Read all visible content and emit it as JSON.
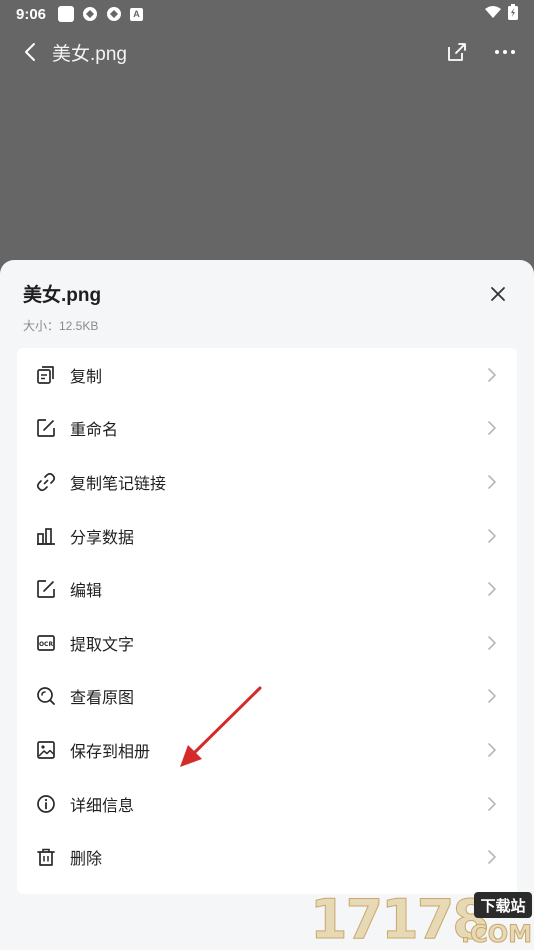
{
  "status_bar": {
    "time": "9:06",
    "badge_letter": "A",
    "icons_left": [
      "notification-square-icon",
      "sync-ring-icon",
      "sync-ring-icon",
      "a-badge-icon"
    ],
    "icons_right": [
      "wifi-icon",
      "battery-icon"
    ]
  },
  "app_bar": {
    "title": "美女.png",
    "actions": [
      "share-icon",
      "more-icon"
    ]
  },
  "sheet": {
    "title": "美女.png",
    "size": "大小：12.5KB",
    "items": [
      {
        "label": "复制",
        "icon": "copy-icon"
      },
      {
        "label": "重命名",
        "icon": "rename-icon"
      },
      {
        "label": "复制笔记链接",
        "icon": "link-icon"
      },
      {
        "label": "分享数据",
        "icon": "bar-chart-icon"
      },
      {
        "label": "编辑",
        "icon": "edit-icon"
      },
      {
        "label": "提取文字",
        "icon": "ocr-icon"
      },
      {
        "label": "查看原图",
        "icon": "view-image-icon"
      },
      {
        "label": "保存到相册",
        "icon": "image-icon"
      },
      {
        "label": "详细信息",
        "icon": "info-icon"
      },
      {
        "label": "删除",
        "icon": "trash-icon"
      }
    ]
  },
  "watermark": {
    "digits": "17178",
    "badge": "下载站",
    "domain": ".COM"
  },
  "colors": {
    "scrim": "#666667",
    "sheet_bg": "#f5f6f8",
    "card_bg": "#ffffff",
    "annotation_arrow": "#d42a2a"
  }
}
